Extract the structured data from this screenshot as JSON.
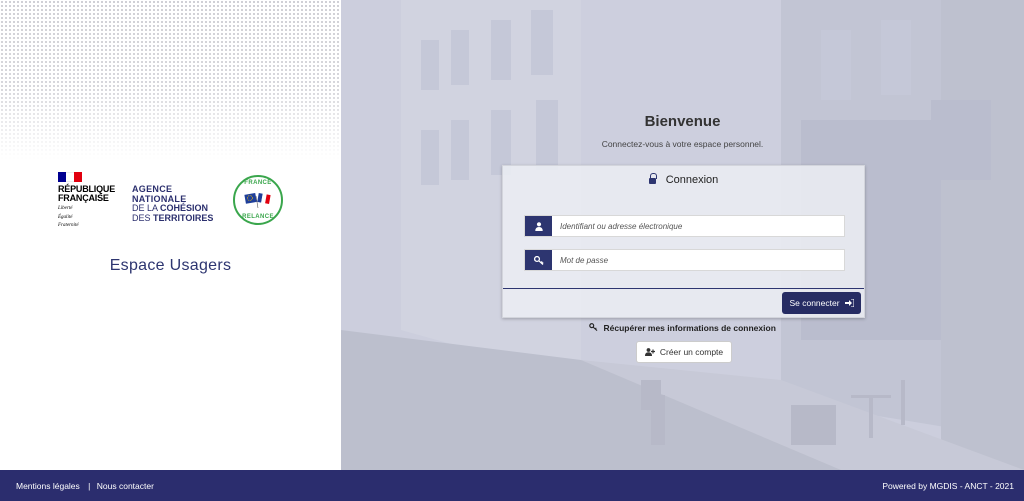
{
  "left": {
    "rf_logo": {
      "title_line1": "RÉPUBLIQUE",
      "title_line2": "FRANÇAISE",
      "motto1": "Liberté",
      "motto2": "Égalité",
      "motto3": "Fraternité"
    },
    "anct_logo": {
      "line1": "AGENCE",
      "line2": "NATIONALE",
      "line3_prefix": "DE LA ",
      "line3_bold": "COHÉSION",
      "line4_prefix": "DES ",
      "line4_bold": "TERRITOIRES"
    },
    "relance_logo": {
      "top": "FRANCE",
      "bottom": "RELANCE"
    },
    "espace_title": "Espace Usagers"
  },
  "login": {
    "welcome": "Bienvenue",
    "subtitle": "Connectez-vous à votre espace personnel.",
    "card_title": "Connexion",
    "username_placeholder": "Identifiant ou adresse électronique",
    "password_placeholder": "Mot de passe",
    "submit_label": "Se connecter",
    "recover_label": "Récupérer mes informations de connexion",
    "create_label": "Créer un compte"
  },
  "footer": {
    "legal": "Mentions légales",
    "separator": "|",
    "contact": "Nous contacter",
    "powered": "Powered by MGDIS - ANCT - 2021"
  },
  "colors": {
    "brand": "#2d3570",
    "footer_bg": "#2b2d6e",
    "button_bg": "#262c63"
  },
  "icons": {
    "card": "lock-icon",
    "username": "user-icon",
    "password": "key-icon",
    "submit": "sign-in-icon",
    "recover": "key-icon",
    "create": "user-plus-icon"
  }
}
